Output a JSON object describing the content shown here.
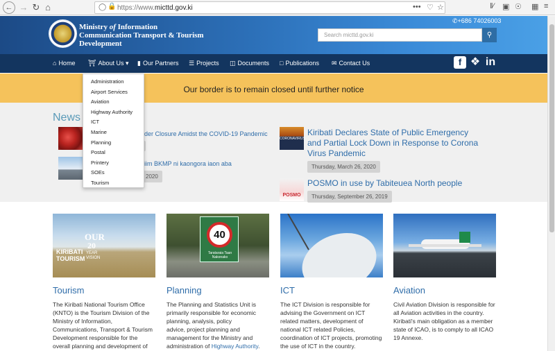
{
  "browser": {
    "url_prefix": "https://www.",
    "url_domain": "micttd.gov.ki",
    "dots": "•••"
  },
  "header": {
    "ministry_line1": "Ministry",
    "ministry_of": "of",
    "ministry_line1b": "Information",
    "ministry_line2": "Communication Transport & Tourism",
    "ministry_line3": "Development",
    "phone": "+686 74026003",
    "search_placeholder": "Search micttd.gov.ki"
  },
  "nav": {
    "items": [
      {
        "label": "Home",
        "icon": "home-icon"
      },
      {
        "label": "About Us",
        "icon": "bank-icon"
      },
      {
        "label": "Our Partners",
        "icon": "bookmark-icon"
      },
      {
        "label": "Projects",
        "icon": "list-icon"
      },
      {
        "label": "Documents",
        "icon": "folder-icon"
      },
      {
        "label": "Publications",
        "icon": "file-icon"
      },
      {
        "label": "Contact Us",
        "icon": "envelope-icon"
      }
    ],
    "social": [
      "facebook-icon",
      "twitter-icon",
      "linkedin-icon"
    ]
  },
  "dropdown": [
    "Administration",
    "Airport Services",
    "Aviation",
    "Highway Authority",
    "ICT",
    "Marine",
    "Planning",
    "Postal",
    "Printery",
    "SOEs",
    "Tourism"
  ],
  "banner": "Our border is to remain closed until further notice",
  "news": {
    "title": "News",
    "left": [
      {
        "text": "der Closure Amidst the COVID-19 Pandemic",
        "date": ""
      },
      {
        "text": "iim BKMP ni kaongora iaon aba",
        "date": "2020"
      }
    ],
    "right": [
      {
        "line1": "Kiribati Declares State of Public Emergency",
        "line2": "and Partial Lock Down in Response to Corona",
        "line3": "Virus Pandemic",
        "date": "Thursday, March 26, 2020",
        "thumb_text": "CORONAVIRUS"
      },
      {
        "line1": "POSMO in use by Tabiteuea North people",
        "date": "Thursday, September 26, 2019",
        "thumb_text": "POSMO"
      }
    ]
  },
  "cards": [
    {
      "title": "Tourism",
      "image_text1": "OUR",
      "image_text2": "20",
      "image_text3": "YEAR",
      "image_text4": "VISION",
      "image_text5": "KIRIBATI",
      "image_text6": "TOURISM",
      "body": [
        "The Kiribati National Tourism Office",
        "(KNTO) is the Tourism Division of the",
        "Ministry of Information,",
        "Communications, Transport & Tourism",
        "Development responsible for the",
        "overall planning and development of"
      ]
    },
    {
      "title": "Planning",
      "image_text1": "40",
      "image_text2": "Tarataraia Taan",
      "image_text3": "Nakonako",
      "body": [
        "The Planning and Statistics Unit is",
        "primarily responsible for economic",
        "planning, analysis, policy",
        "advice, project planning and",
        "management for the Ministry and",
        "administration of "
      ],
      "link": "Highway Authority",
      "link_after": "."
    },
    {
      "title": "ICT",
      "body": [
        "The ICT Division is responsible for",
        "advising the Government on ICT",
        "related matters, development of",
        "national ICT related Policies,",
        "coordination of ICT projects, promoting",
        "the use of ICT in the country."
      ]
    },
    {
      "title": "Aviation",
      "body": [
        "Civil Aviation Division is responsible for",
        "all Aviation activities in the country.",
        "Kiribati's main obligation as a member",
        "state of ICAO, is to comply to all ICAO",
        "19 Annexe."
      ]
    }
  ]
}
